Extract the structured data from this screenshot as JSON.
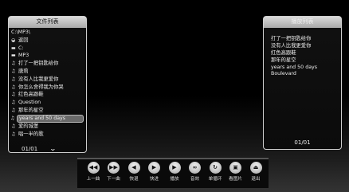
{
  "file_panel": {
    "title": "文件列表",
    "path": "C:\\MP3\\",
    "items": [
      {
        "icon": "back-icon",
        "glyph": "◒",
        "label": "返回"
      },
      {
        "icon": "drive-icon",
        "glyph": "▬",
        "label": "C:"
      },
      {
        "icon": "folder-icon",
        "glyph": "▬",
        "label": "MP3"
      },
      {
        "icon": "music-note-icon",
        "glyph": "♫",
        "label": "打了一把钥匙给你"
      },
      {
        "icon": "music-note-icon",
        "glyph": "♫",
        "label": "唐莉"
      },
      {
        "icon": "music-note-icon",
        "glyph": "♫",
        "label": "没有人比我更爱你"
      },
      {
        "icon": "music-note-icon",
        "glyph": "♫",
        "label": "你怎么舍得我为你哭"
      },
      {
        "icon": "music-note-icon",
        "glyph": "♫",
        "label": "红色高跟鞋"
      },
      {
        "icon": "music-note-icon",
        "glyph": "♫",
        "label": "Question"
      },
      {
        "icon": "music-note-icon",
        "glyph": "♫",
        "label": "那年的星空"
      },
      {
        "icon": "music-note-icon",
        "glyph": "♫",
        "label": "years and 50 days",
        "selected": true
      },
      {
        "icon": "music-note-icon",
        "glyph": "♫",
        "label": "爱的城堡"
      },
      {
        "icon": "music-note-icon",
        "glyph": "♫",
        "label": "唱一半的歌"
      }
    ],
    "page": "01/01",
    "page_chevron": "⌄"
  },
  "play_panel": {
    "title": "播放列表",
    "items": [
      "打了一把钥匙给你",
      "没有人比我更爱你",
      "红色高跟鞋",
      "那年的星空",
      "years and 50 days",
      "Boulevard"
    ],
    "page": "01/01"
  },
  "toolbar": {
    "buttons": [
      {
        "name": "prev-track-button",
        "icon": "prev-icon",
        "glyph": "◀◀",
        "label": "上一曲"
      },
      {
        "name": "next-track-button",
        "icon": "next-icon",
        "glyph": "▶▶",
        "label": "下一曲"
      },
      {
        "name": "rewind-button",
        "icon": "rewind-icon",
        "glyph": "◀",
        "label": "快退"
      },
      {
        "name": "fast-forward-button",
        "icon": "fast-forward-icon",
        "glyph": "▶",
        "label": "快进"
      },
      {
        "name": "play-button",
        "icon": "play-icon",
        "glyph": "▶",
        "label": "播放"
      },
      {
        "name": "sound-effect-button",
        "icon": "sound-effect-icon",
        "glyph": "∞",
        "label": "音效"
      },
      {
        "name": "single-loop-button",
        "icon": "single-loop-icon",
        "glyph": "↻",
        "label": "单循环"
      },
      {
        "name": "view-picture-button",
        "icon": "picture-icon",
        "glyph": "▣",
        "label": "看图片"
      },
      {
        "name": "exit-button",
        "icon": "exit-icon",
        "glyph": "⏏",
        "label": "退出"
      }
    ]
  }
}
